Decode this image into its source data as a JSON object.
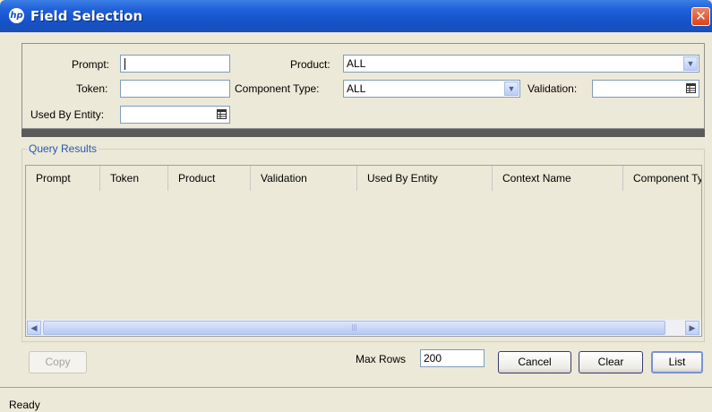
{
  "window": {
    "title": "Field Selection",
    "logo_text": "hp",
    "close_glyph": "✕"
  },
  "filters": {
    "prompt_label": "Prompt:",
    "prompt_value": "",
    "token_label": "Token:",
    "token_value": "",
    "used_by_entity_label": "Used By Entity:",
    "used_by_entity_value": "",
    "product_label": "Product:",
    "product_value": "ALL",
    "component_type_label": "Component Type:",
    "component_type_value": "ALL",
    "validation_label": "Validation:",
    "validation_value": ""
  },
  "results": {
    "group_title": "Query Results",
    "columns": [
      "Prompt",
      "Token",
      "Product",
      "Validation",
      "Used By Entity",
      "Context Name",
      "Component Ty"
    ],
    "rows": [],
    "scroll_left_glyph": "◀",
    "scroll_right_glyph": "▶",
    "thumb_grip": "|||"
  },
  "footer": {
    "copy_label": "Copy",
    "max_rows_label": "Max Rows",
    "max_rows_value": "200",
    "cancel_label": "Cancel",
    "clear_label": "Clear",
    "list_label": "List"
  },
  "status": {
    "text": "Ready"
  },
  "colors": {
    "titlebar": "#1552c8",
    "accent": "#2457b8",
    "close": "#d9431c"
  }
}
